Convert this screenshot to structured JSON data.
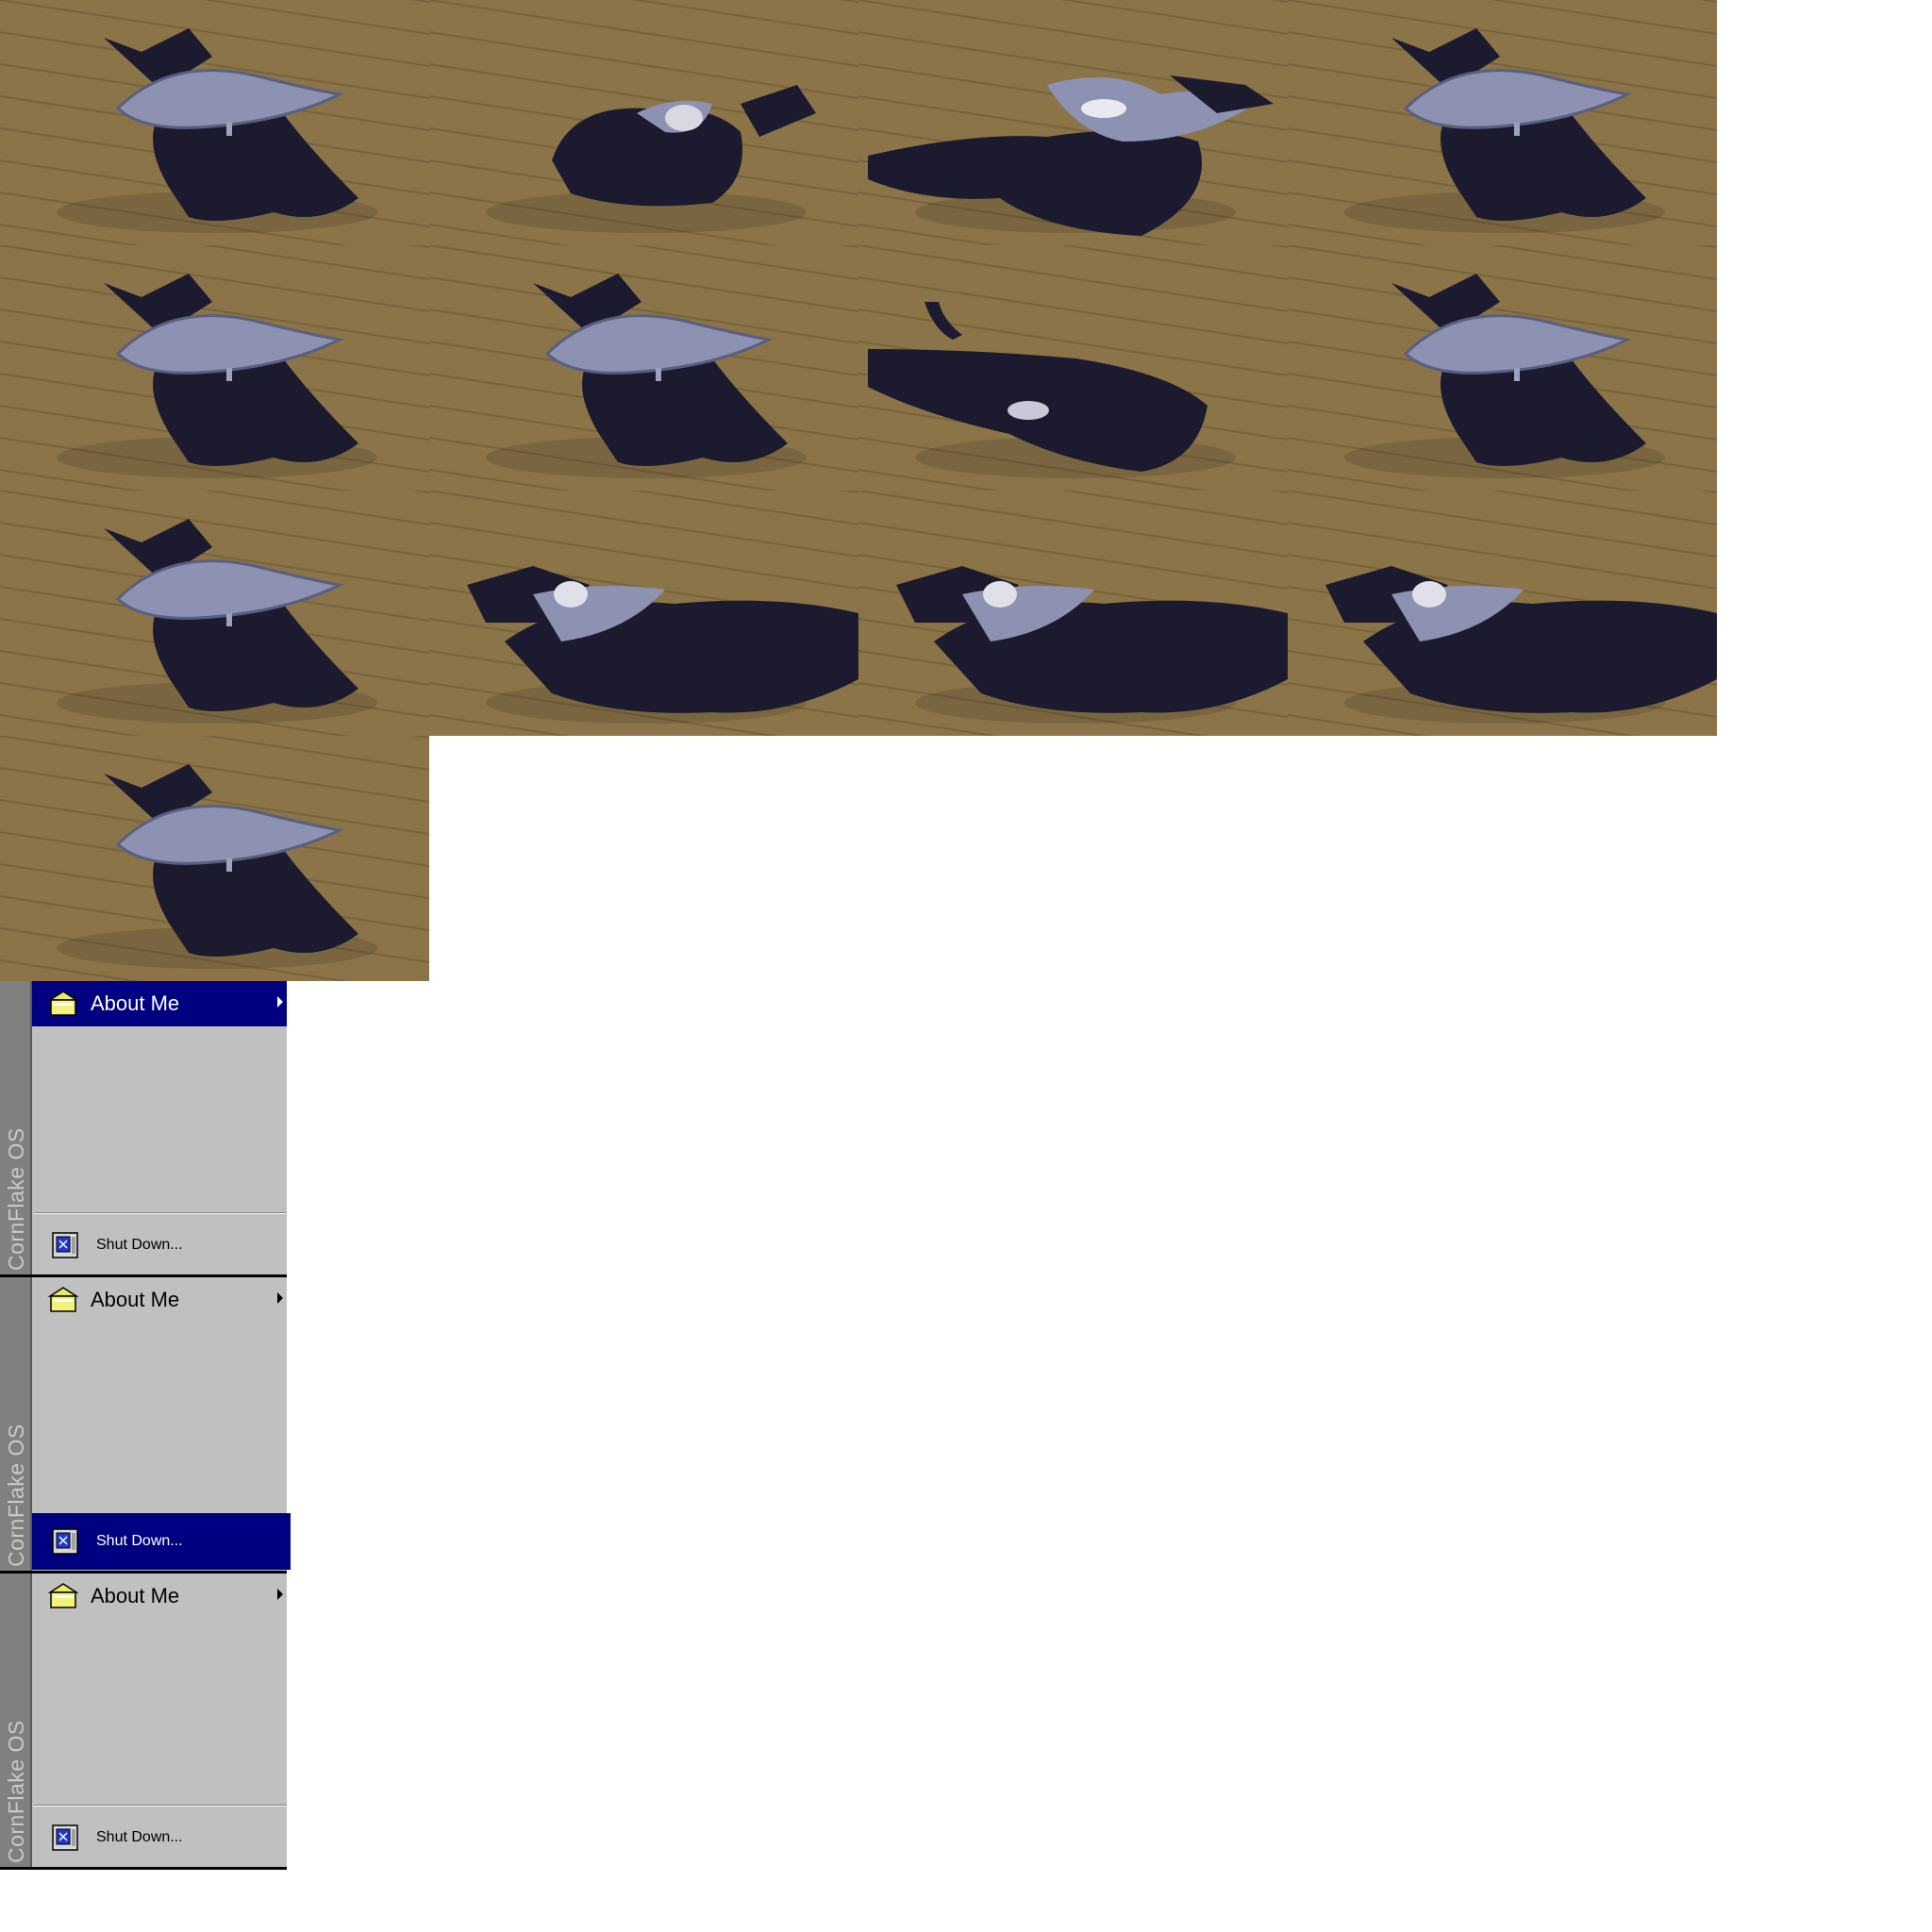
{
  "sprite_sheet": {
    "frames": [
      {
        "pose": "hat"
      },
      {
        "pose": "crouch"
      },
      {
        "pose": "leap"
      },
      {
        "pose": "hat"
      },
      {
        "pose": "hat"
      },
      {
        "pose": "hat"
      },
      {
        "pose": "stretch"
      },
      {
        "pose": "hat"
      },
      {
        "pose": "hat"
      },
      {
        "pose": "lunge"
      },
      {
        "pose": "lunge"
      },
      {
        "pose": "lunge"
      },
      {
        "pose": "hat"
      }
    ]
  },
  "menus": [
    {
      "banner": "CornFlake OS",
      "top_item": {
        "label": "About Me",
        "icon": "folder-icon",
        "highlighted": true
      },
      "bottom_item": {
        "label": "Shut Down...",
        "icon": "computer-icon",
        "highlighted": false
      }
    },
    {
      "banner": "CornFlake OS",
      "top_item": {
        "label": "About Me",
        "icon": "folder-icon",
        "highlighted": false
      },
      "bottom_item": {
        "label": "Shut Down...",
        "icon": "computer-icon",
        "highlighted": true
      }
    },
    {
      "banner": "CornFlake OS",
      "top_item": {
        "label": "About Me",
        "icon": "folder-icon",
        "highlighted": false
      },
      "bottom_item": {
        "label": "Shut Down...",
        "icon": "computer-icon",
        "highlighted": false
      }
    }
  ],
  "colors": {
    "floor": "#8a7448",
    "floor_line": "#6e5c38",
    "cat": "#1c1a2e",
    "hat": "#8d92b2",
    "menu_bg": "#c0c0c0",
    "highlight": "#000080",
    "banner": "#808080"
  }
}
